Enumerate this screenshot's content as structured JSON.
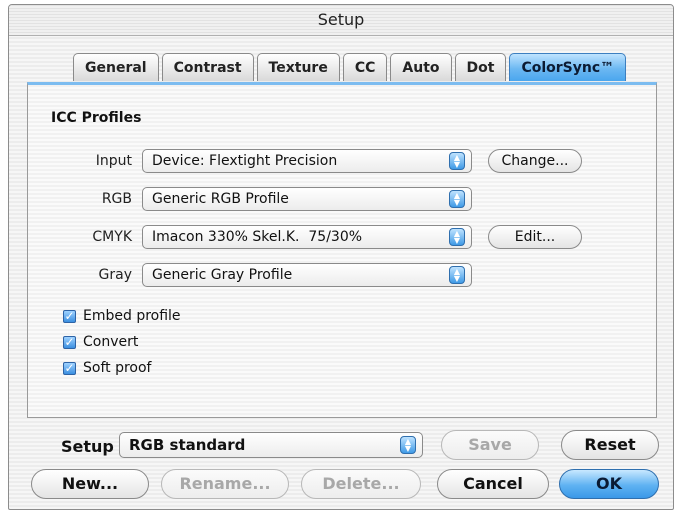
{
  "window": {
    "title": "Setup"
  },
  "tabs": [
    {
      "label": "General"
    },
    {
      "label": "Contrast"
    },
    {
      "label": "Texture"
    },
    {
      "label": "CC"
    },
    {
      "label": "Auto"
    },
    {
      "label": "Dot"
    },
    {
      "label": "ColorSync™",
      "active": true
    }
  ],
  "icc": {
    "title": "ICC Profiles",
    "input": {
      "label": "Input",
      "value": "Device: Flextight Precision",
      "button": "Change..."
    },
    "rgb": {
      "label": "RGB",
      "value": "Generic RGB Profile"
    },
    "cmyk": {
      "label": "CMYK",
      "value": "Imacon 330% Skel.K.  75/30%",
      "button": "Edit..."
    },
    "gray": {
      "label": "Gray",
      "value": "Generic Gray Profile"
    }
  },
  "options": {
    "embed": {
      "label": "Embed profile",
      "checked": true
    },
    "convert": {
      "label": "Convert",
      "checked": true
    },
    "softproof": {
      "label": "Soft proof",
      "checked": true
    }
  },
  "setup": {
    "label": "Setup",
    "value": "RGB standard",
    "save": "Save",
    "reset": "Reset"
  },
  "footer": {
    "new": "New...",
    "rename": "Rename...",
    "delete": "Delete...",
    "cancel": "Cancel",
    "ok": "OK"
  },
  "icons": {
    "popup_arrows": "up-down-arrows-icon",
    "checkmark": "checkmark-icon"
  },
  "colors": {
    "accent": "#4aa6ee",
    "accent_border": "#2f6fae"
  }
}
